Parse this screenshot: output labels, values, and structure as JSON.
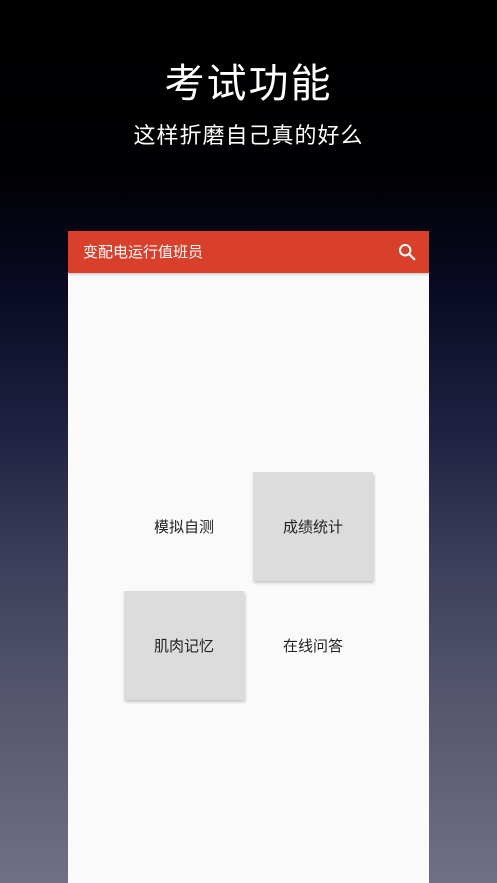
{
  "promo": {
    "title": "考试功能",
    "subtitle": "这样折磨自己真的好么"
  },
  "app_bar": {
    "title": "变配电运行值班员",
    "search_icon": "search-icon"
  },
  "menu": {
    "items": [
      {
        "label": "模拟自测"
      },
      {
        "label": "成绩统计"
      },
      {
        "label": "肌肉记忆"
      },
      {
        "label": "在线问答"
      }
    ]
  },
  "colors": {
    "app_bar": "#d8402c",
    "content_background": "#fafafa",
    "tile_shaded": "#dcdcdc",
    "promo_text": "#ffffff"
  }
}
